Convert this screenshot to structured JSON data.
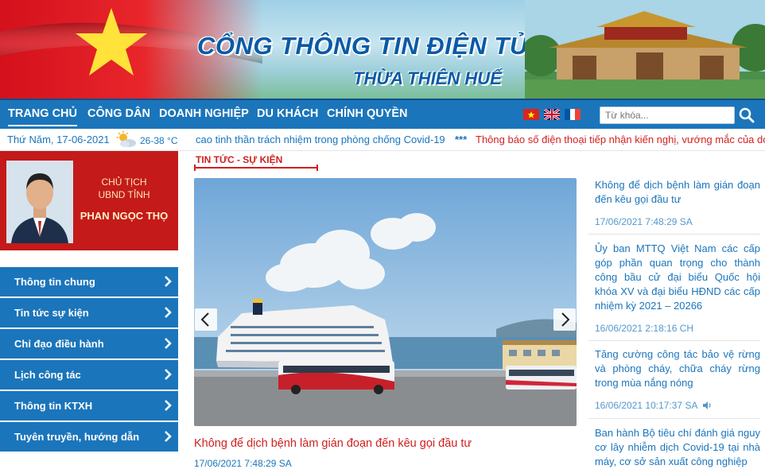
{
  "banner": {
    "title_main": "CỔNG THÔNG TIN ĐIỆN TỬ",
    "title_sub": "THỪA THIÊN HUẾ"
  },
  "nav": {
    "items": [
      {
        "label": "TRANG CHỦ",
        "active": true
      },
      {
        "label": "CÔNG DÂN"
      },
      {
        "label": "DOANH NGHIỆP"
      },
      {
        "label": "DU KHÁCH"
      },
      {
        "label": "CHÍNH QUYỀN"
      }
    ],
    "languages": [
      "vietnamese-flag-icon",
      "uk-flag-icon",
      "french-flag-icon"
    ],
    "search_placeholder": "Từ khóa..."
  },
  "infobar": {
    "date": "Thứ Năm, 17-06-2021",
    "temperature": "26-38 °C",
    "ticker1": "cao tinh thần trách nhiệm trong phòng chống Covid-19",
    "ticker_separator": "***",
    "ticker2": "Thông báo số điện thoại tiếp nhận kiến nghị, vướng mắc của doanh"
  },
  "leader": {
    "role_line1": "CHỦ TỊCH",
    "role_line2": "UBND TỈNH",
    "name": "PHAN NGỌC THỌ"
  },
  "menu": {
    "items": [
      {
        "label": "Thông tin chung"
      },
      {
        "label": "Tin tức sự kiện"
      },
      {
        "label": "Chỉ đạo điều hành"
      },
      {
        "label": "Lịch công tác"
      },
      {
        "label": "Thông tin KTXH"
      },
      {
        "label": "Tuyên truyền, hướng dẫn"
      }
    ]
  },
  "main": {
    "section_title": "TIN TỨC - SỰ KIỆN",
    "featured": {
      "title": "Không để dịch bệnh làm gián đoạn đến kêu gọi đầu tư",
      "time": "17/06/2021 7:48:29 SA"
    }
  },
  "news": [
    {
      "title": "Không để dịch bệnh làm gián đoạn đến kêu gọi đầu tư",
      "time": "17/06/2021 7:48:29 SA"
    },
    {
      "title": "Ủy ban MTTQ Việt Nam các cấp góp phần quan trọng cho thành công bầu cử đại biểu Quốc hội khóa XV và đại biểu HĐND các cấp nhiệm kỳ 2021 – 20266",
      "time": "16/06/2021 2:18:16 CH"
    },
    {
      "title": "Tăng cường công tác bảo vệ rừng và phòng cháy, chữa cháy rừng trong mùa nắng nóng",
      "time": "16/06/2021 10:17:37 SA",
      "audio": true
    },
    {
      "title": "Ban hành Bộ tiêu chí đánh giá nguy cơ lây nhiễm dịch Covid-19 tại nhà máy, cơ sở sản xuất công nghiệp",
      "time": ""
    }
  ],
  "colors": {
    "primary": "#1b75bb",
    "accent_red": "#d01f1f",
    "leader_bg": "#c41a1a"
  }
}
